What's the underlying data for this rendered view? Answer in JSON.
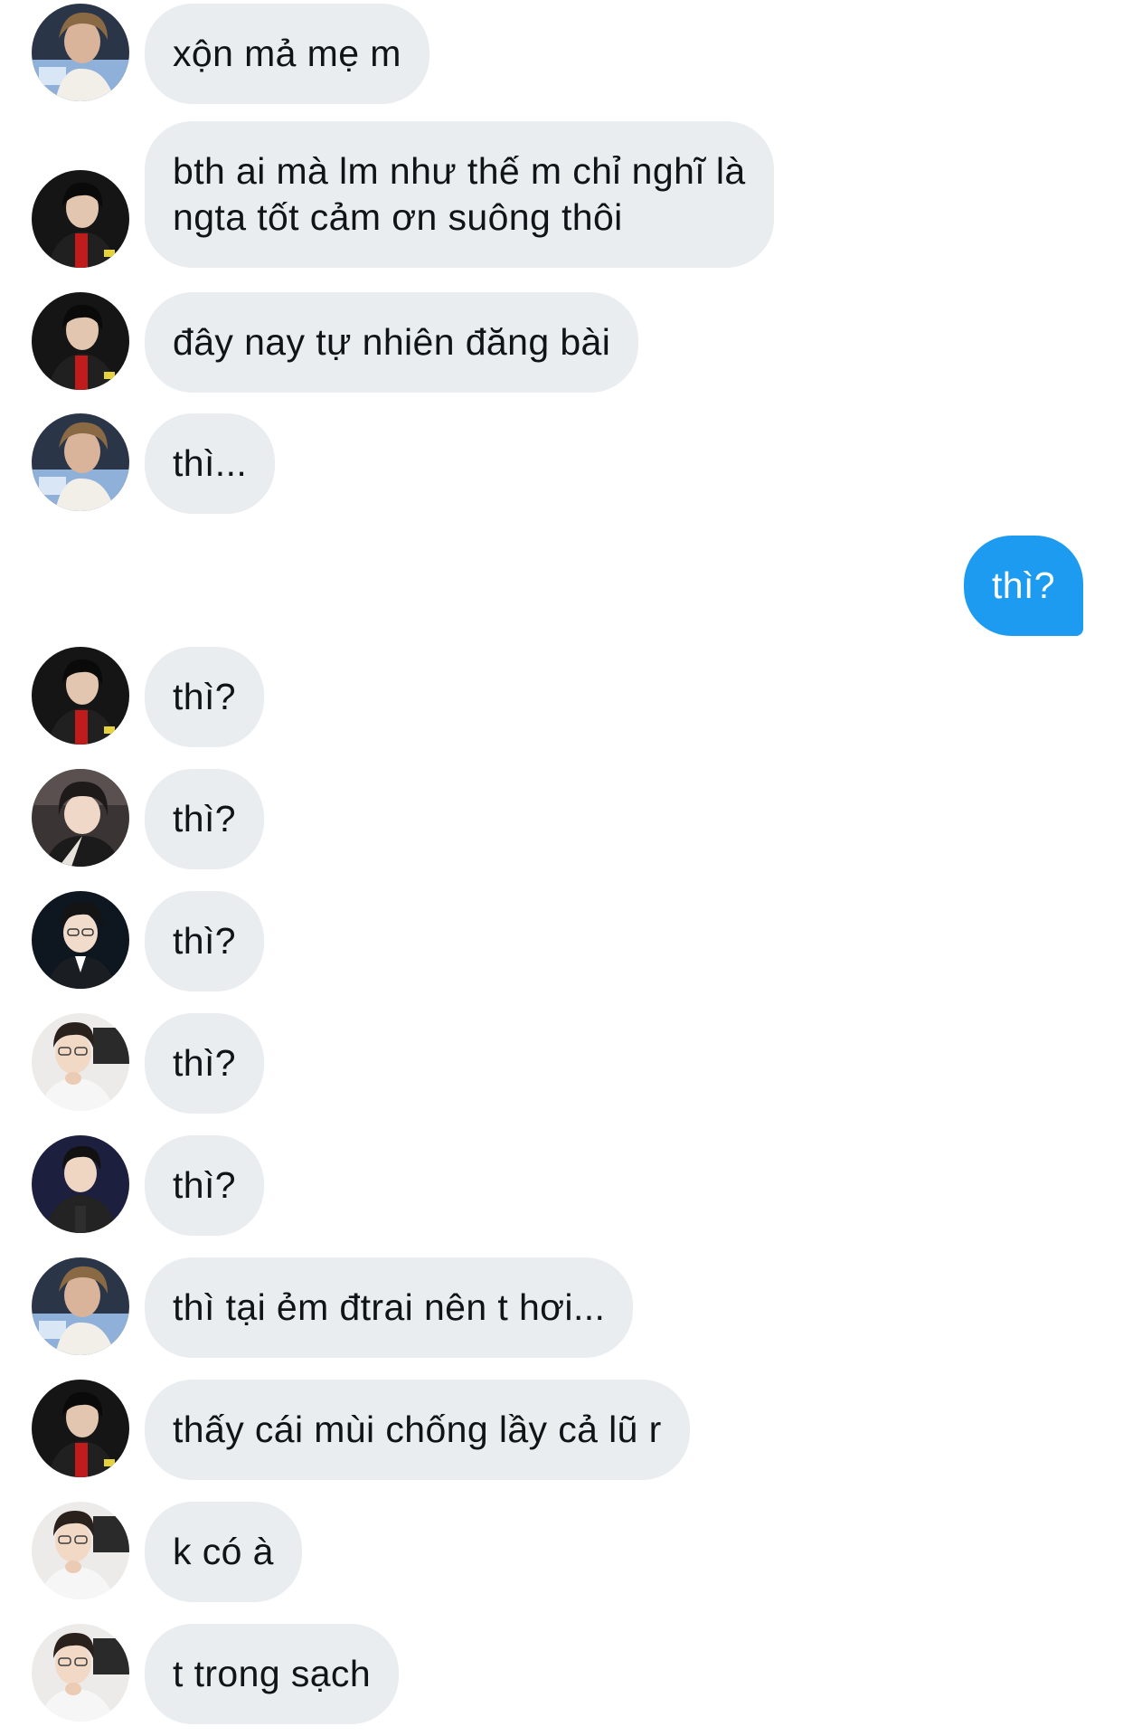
{
  "conversation": {
    "messages": [
      {
        "side": "in",
        "avatar": "user-a",
        "text": "xộn mả mẹ m"
      },
      {
        "side": "in",
        "avatar": "user-b",
        "text": "bth ai mà lm như thế m chỉ nghĩ là\nngta tốt cảm ơn suông thôi"
      },
      {
        "side": "in",
        "avatar": "user-b",
        "text": "đây nay tự nhiên đăng bài"
      },
      {
        "side": "in",
        "avatar": "user-a",
        "text": "thì..."
      },
      {
        "side": "out",
        "avatar": "",
        "text": "thì?"
      },
      {
        "side": "in",
        "avatar": "user-b",
        "text": "thì?"
      },
      {
        "side": "in",
        "avatar": "user-c",
        "text": "thì?"
      },
      {
        "side": "in",
        "avatar": "user-d",
        "text": "thì?"
      },
      {
        "side": "in",
        "avatar": "user-e",
        "text": "thì?"
      },
      {
        "side": "in",
        "avatar": "user-f",
        "text": "thì?"
      },
      {
        "side": "in",
        "avatar": "user-a",
        "text": "thì tại ẻm đtrai nên t hơi..."
      },
      {
        "side": "in",
        "avatar": "user-b",
        "text": "thấy cái mùi chống lầy cả lũ r"
      },
      {
        "side": "in",
        "avatar": "user-e",
        "text": "k có à"
      },
      {
        "side": "in",
        "avatar": "user-e",
        "text": "t trong sạch"
      }
    ]
  },
  "colors": {
    "incoming_bubble": "#e9edf0",
    "outgoing_bubble": "#1d9bf0",
    "incoming_text": "#0f1419",
    "outgoing_text": "#ffffff"
  }
}
